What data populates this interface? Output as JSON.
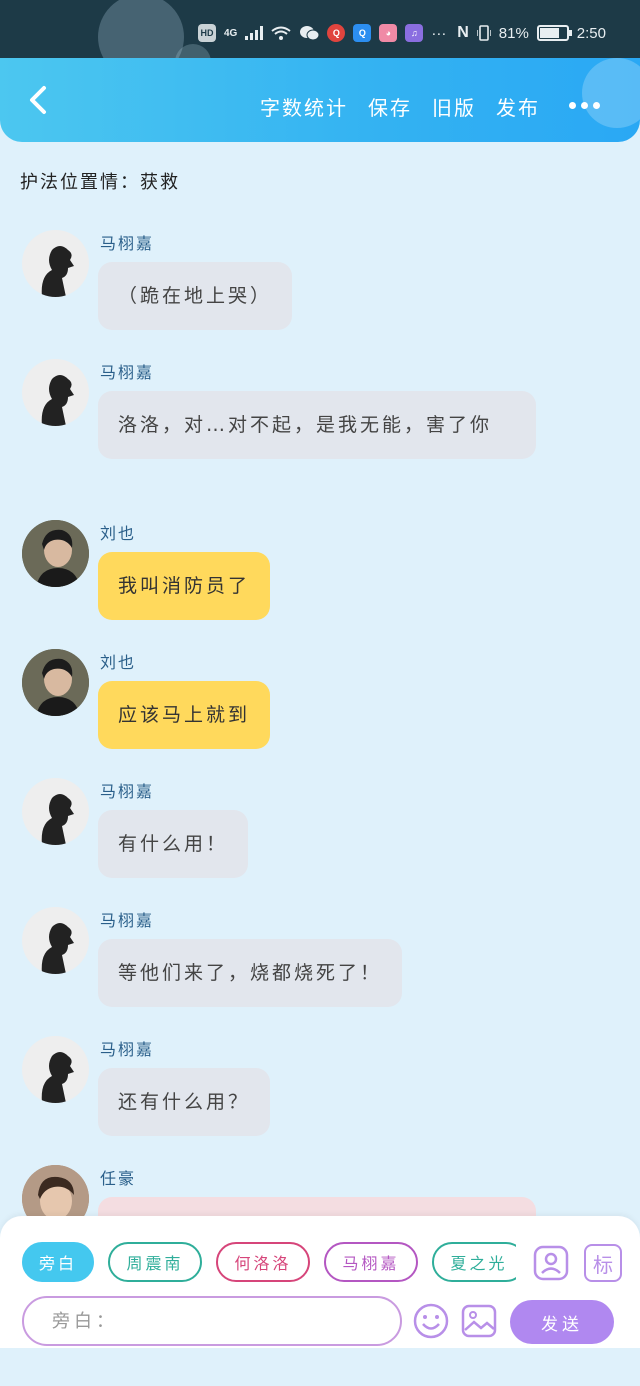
{
  "status_bar": {
    "left_icons": [
      "HD",
      "4G"
    ],
    "app_icons": [
      "wechat-icon",
      "red-app-icon",
      "search-app-icon",
      "cat-app-icon",
      "music-app-icon"
    ],
    "more": "···",
    "battery": "81%",
    "battery_level": 0.81,
    "time": "2:50"
  },
  "header": {
    "actions": [
      "字数统计",
      "保存",
      "旧版",
      "发布"
    ]
  },
  "intro": "护法位置情：获救",
  "messages": [
    {
      "sender": "马栩嘉",
      "text": "（跪在地上哭）",
      "color": "gray"
    },
    {
      "sender": "马栩嘉",
      "text": "洛洛，对…对不起，是我无能，害了你",
      "color": "gray"
    },
    {
      "sender": "刘也",
      "text": "我叫消防员了",
      "color": "yellow"
    },
    {
      "sender": "刘也",
      "text": "应该马上就到",
      "color": "yellow"
    },
    {
      "sender": "马栩嘉",
      "text": "有什么用！",
      "color": "gray"
    },
    {
      "sender": "马栩嘉",
      "text": "等他们来了，烧都烧死了！",
      "color": "gray"
    },
    {
      "sender": "马栩嘉",
      "text": "还有什么用？",
      "color": "gray"
    },
    {
      "sender": "任豪",
      "text": "",
      "color": "pink"
    }
  ],
  "composer": {
    "roles": [
      {
        "label": "旁白",
        "color": "#44c8ef",
        "active": true
      },
      {
        "label": "周震南",
        "color": "#2fae9a",
        "active": false
      },
      {
        "label": "何洛洛",
        "color": "#d6457a",
        "active": false
      },
      {
        "label": "马栩嘉",
        "color": "#b457c2",
        "active": false
      },
      {
        "label": "夏之光",
        "color": "#2fae9a",
        "active": false
      }
    ],
    "tag_label": "标",
    "input_placeholder": "旁白：",
    "send_label": "发送"
  }
}
